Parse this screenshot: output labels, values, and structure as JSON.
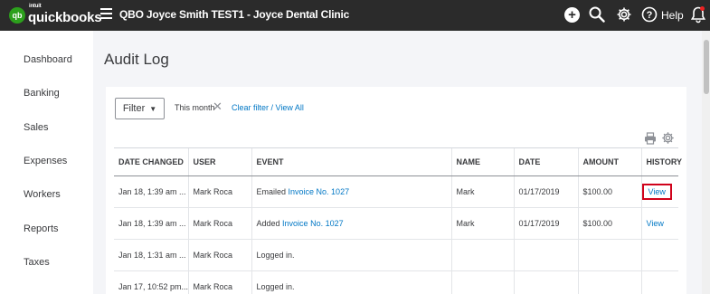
{
  "app": {
    "logo_intuit": "intuit",
    "logo_text": "quickbooks",
    "logo_mark": "qb",
    "company_title": "QBO Joyce Smith TEST1 - Joyce Dental Clinic",
    "help_label": "Help",
    "plus_glyph": "+"
  },
  "colors": {
    "topbar": "#2b2b2b",
    "brand_green": "#2ca01c",
    "link_blue": "#0077c5",
    "highlight_red": "#d0021b"
  },
  "icons": {
    "menu": "hamburger-icon",
    "create": "plus-icon",
    "search": "search-icon",
    "settings": "gear-icon",
    "help": "help-icon",
    "notifications": "bell-icon",
    "print": "print-icon",
    "table_settings": "gear-icon",
    "clear_filter": "close-icon"
  },
  "sidebar": {
    "items": [
      "Dashboard",
      "Banking",
      "Sales",
      "Expenses",
      "Workers",
      "Reports",
      "Taxes"
    ]
  },
  "page": {
    "title": "Audit Log"
  },
  "filter": {
    "button_label": "Filter",
    "caret": "▼",
    "active_filter": "This month",
    "clear_x": "✕",
    "clear_link": "Clear filter / View All"
  },
  "table": {
    "headers": [
      "DATE CHANGED",
      "USER",
      "EVENT",
      "NAME",
      "DATE",
      "AMOUNT",
      "HISTORY"
    ],
    "rows": [
      {
        "date_changed": "Jan 18, 1:39 am ...",
        "user": "Mark Roca",
        "event_prefix": "Emailed",
        "event_link": "Invoice No. 1027",
        "name": "Mark",
        "date": "01/17/2019",
        "amount": "$100.00",
        "history": "View",
        "highlighted": true
      },
      {
        "date_changed": "Jan 18, 1:39 am ...",
        "user": "Mark Roca",
        "event_prefix": "Added",
        "event_link": "Invoice No. 1027",
        "name": "Mark",
        "date": "01/17/2019",
        "amount": "$100.00",
        "history": "View",
        "highlighted": false
      },
      {
        "date_changed": "Jan 18, 1:31 am ...",
        "user": "Mark Roca",
        "event_prefix": "Logged in.",
        "event_link": "",
        "name": "",
        "date": "",
        "amount": "",
        "history": "",
        "highlighted": false
      },
      {
        "date_changed": "Jan 17, 10:52 pm...",
        "user": "Mark Roca",
        "event_prefix": "Logged in.",
        "event_link": "",
        "name": "",
        "date": "",
        "amount": "",
        "history": "",
        "highlighted": false
      }
    ]
  }
}
